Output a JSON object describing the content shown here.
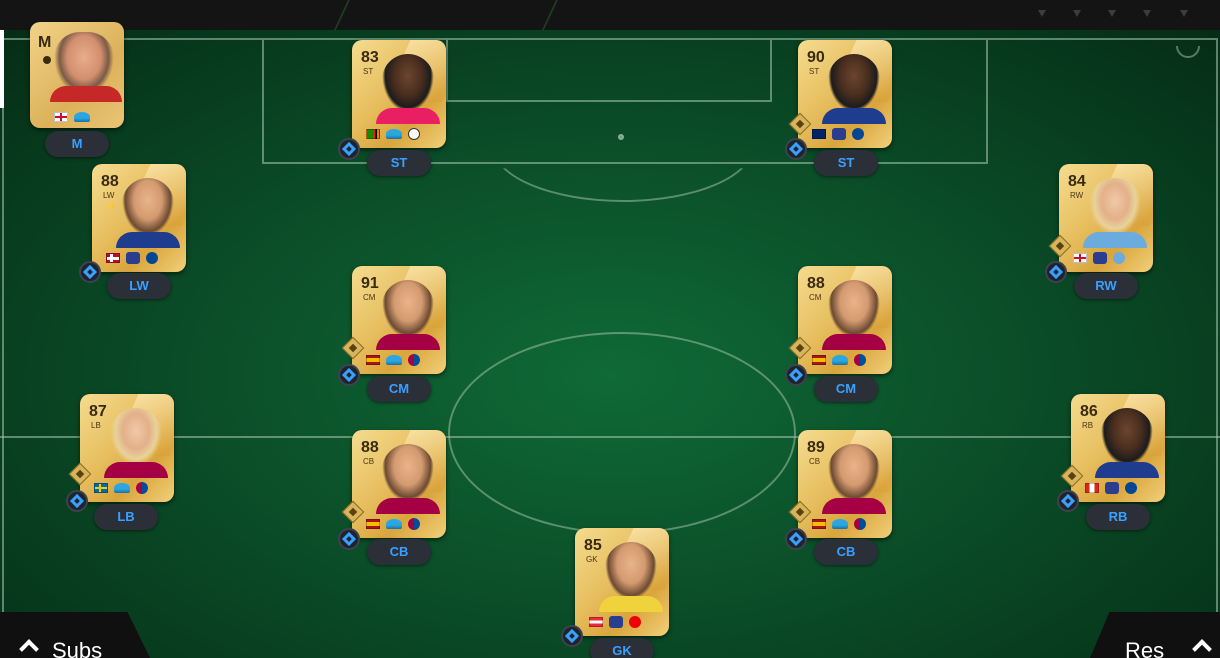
{
  "colors": {
    "pill_text": "#3aa0ff",
    "pill_bg": "#2b2f38",
    "pitch": "#0b4f29"
  },
  "manager": {
    "badge": "M",
    "pill": "M",
    "flag": "england",
    "league": "liga-f"
  },
  "players": [
    {
      "id": "st-left",
      "rating": "83",
      "pos": "ST",
      "pill": "ST",
      "flags": [
        "zambia",
        "liga-f",
        "club-white"
      ]
    },
    {
      "id": "st-right",
      "rating": "90",
      "pos": "ST",
      "pill": "ST",
      "flags": [
        "australia",
        "wsl",
        "chelsea"
      ]
    },
    {
      "id": "lw",
      "rating": "88",
      "pos": "LW",
      "pill": "LW",
      "flags": [
        "norway",
        "wsl",
        "chelsea"
      ]
    },
    {
      "id": "rw",
      "rating": "84",
      "pos": "RW",
      "pill": "RW",
      "flags": [
        "england",
        "wsl",
        "man-city"
      ]
    },
    {
      "id": "cm-left",
      "rating": "91",
      "pos": "CM",
      "pill": "CM",
      "flags": [
        "spain",
        "liga-f",
        "barcelona"
      ]
    },
    {
      "id": "cm-right",
      "rating": "88",
      "pos": "CM",
      "pill": "CM",
      "flags": [
        "spain",
        "liga-f",
        "barcelona"
      ]
    },
    {
      "id": "lb",
      "rating": "87",
      "pos": "LB",
      "pill": "LB",
      "flags": [
        "sweden",
        "liga-f",
        "barcelona"
      ]
    },
    {
      "id": "cb-left",
      "rating": "88",
      "pos": "CB",
      "pill": "CB",
      "flags": [
        "spain",
        "liga-f",
        "barcelona"
      ]
    },
    {
      "id": "cb-right",
      "rating": "89",
      "pos": "CB",
      "pill": "CB",
      "flags": [
        "spain",
        "liga-f",
        "barcelona"
      ]
    },
    {
      "id": "rb",
      "rating": "86",
      "pos": "RB",
      "pill": "RB",
      "flags": [
        "canada",
        "wsl",
        "chelsea"
      ]
    },
    {
      "id": "gk",
      "rating": "85",
      "pos": "GK",
      "pill": "GK",
      "flags": [
        "austria",
        "wsl",
        "arsenal"
      ]
    }
  ],
  "tabs": {
    "subs": "Subs",
    "res": "Res"
  }
}
